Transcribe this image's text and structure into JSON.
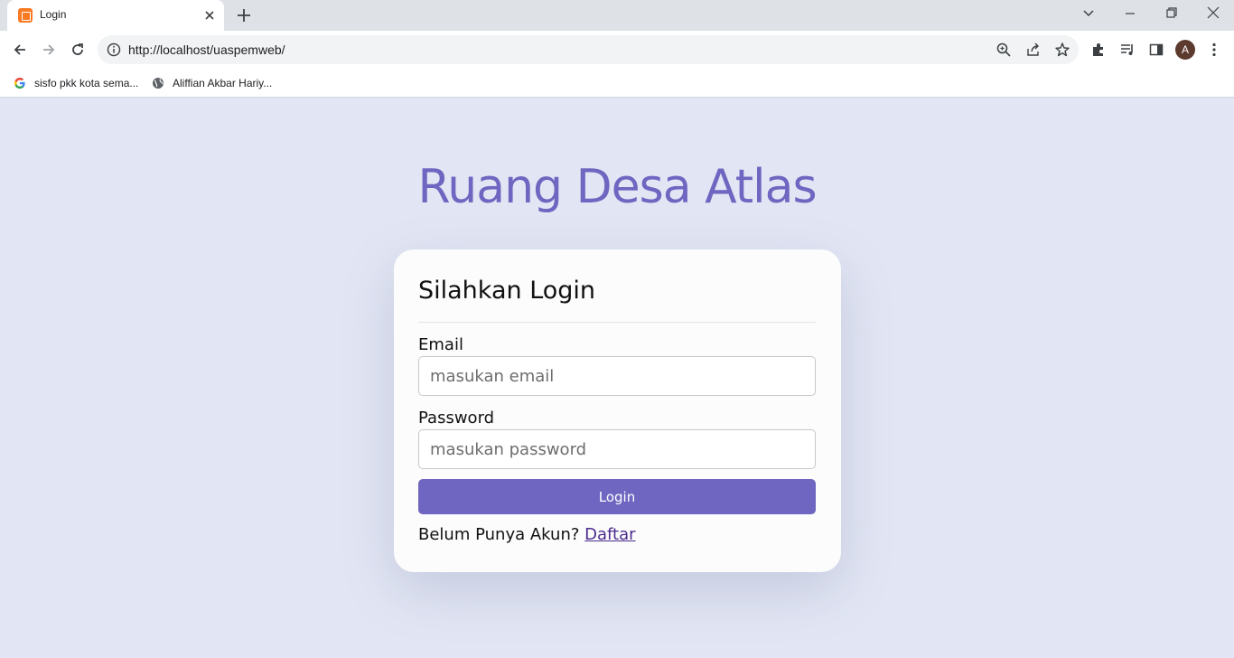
{
  "browser": {
    "tab": {
      "title": "Login",
      "favicon": "xampp-icon"
    },
    "url": "http://localhost/uaspemweb/",
    "profile_initial": "A",
    "bookmarks": [
      {
        "label": "sisfo pkk kota sema...",
        "icon": "google-icon"
      },
      {
        "label": "Aliffian Akbar Hariy...",
        "icon": "globe-icon"
      }
    ]
  },
  "page": {
    "site_title": "Ruang Desa Atlas",
    "card_title": "Silahkan Login",
    "email": {
      "label": "Email",
      "placeholder": "masukan email",
      "value": ""
    },
    "password": {
      "label": "Password",
      "placeholder": "masukan password",
      "value": ""
    },
    "login_button": "Login",
    "register_prompt": "Belum Punya Akun?",
    "register_link": "Daftar"
  },
  "colors": {
    "accent": "#6e66c0",
    "page_background": "#e2e6f4",
    "card_background": "#fcfcfc",
    "link": "#4b2c8f"
  }
}
